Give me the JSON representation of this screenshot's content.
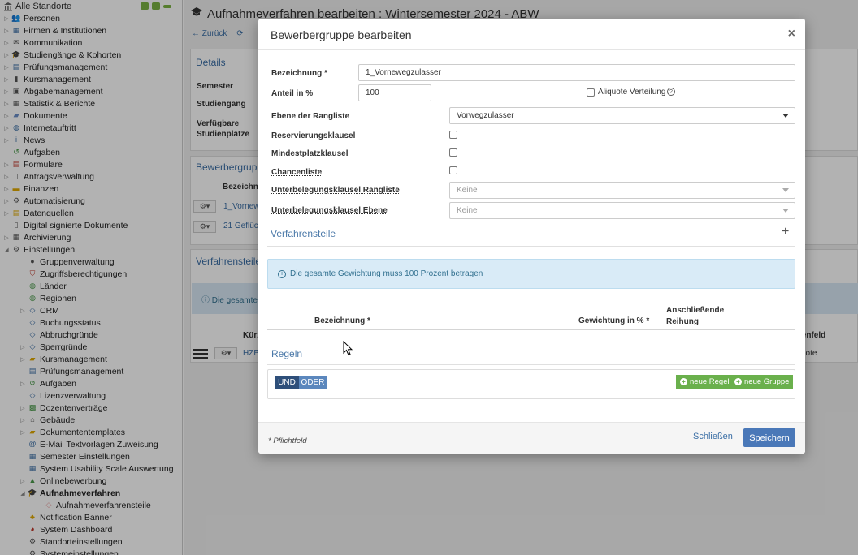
{
  "sidebar": {
    "root": "Alle Standorte",
    "items": [
      {
        "label": "Personen",
        "icon": "people-icon",
        "color": "#8a5a9e",
        "toggle": true
      },
      {
        "label": "Firmen & Institutionen",
        "icon": "chart-icon",
        "color": "#3a6ea5",
        "toggle": true
      },
      {
        "label": "Kommunikation",
        "icon": "mail-icon",
        "color": "#666666",
        "toggle": true
      },
      {
        "label": "Studiengänge & Kohorten",
        "icon": "graduation-icon",
        "color": "#3a6ea5",
        "toggle": true
      },
      {
        "label": "Prüfungsmanagement",
        "icon": "clipboard-icon",
        "color": "#3a6ea5",
        "toggle": true
      },
      {
        "label": "Kursmanagement",
        "icon": "book-icon",
        "color": "#555555",
        "toggle": true
      },
      {
        "label": "Abgabemanagement",
        "icon": "upload-icon",
        "color": "#555555",
        "toggle": true
      },
      {
        "label": "Statistik & Berichte",
        "icon": "report-icon",
        "color": "#555555",
        "toggle": true
      },
      {
        "label": "Dokumente",
        "icon": "folder-icon",
        "color": "#6a8fc7",
        "toggle": true
      },
      {
        "label": "Internetauftritt",
        "icon": "globe-icon",
        "color": "#3a6ea5",
        "toggle": true
      },
      {
        "label": "News",
        "icon": "info-icon",
        "color": "#3a6ea5",
        "toggle": true
      },
      {
        "label": "Aufgaben",
        "icon": "history-icon",
        "color": "#4a9a4a",
        "toggle": false
      },
      {
        "label": "Formulare",
        "icon": "form-icon",
        "color": "#c0392b",
        "toggle": true
      },
      {
        "label": "Antragsverwaltung",
        "icon": "document-icon",
        "color": "#555555",
        "toggle": true
      },
      {
        "label": "Finanzen",
        "icon": "money-icon",
        "color": "#e0a800",
        "toggle": true
      },
      {
        "label": "Automatisierung",
        "icon": "gear-icon",
        "color": "#555555",
        "toggle": true
      },
      {
        "label": "Datenquellen",
        "icon": "database-icon",
        "color": "#e0a800",
        "toggle": true
      },
      {
        "label": "Digital signierte Dokumente",
        "icon": "signed-document-icon",
        "color": "#555555",
        "toggle": false
      },
      {
        "label": "Archivierung",
        "icon": "archive-icon",
        "color": "#555555",
        "toggle": true
      },
      {
        "label": "Einstellungen",
        "icon": "gear-icon",
        "color": "#555555",
        "toggle": true,
        "expanded": true
      }
    ],
    "sub_items": [
      {
        "label": "Gruppenverwaltung",
        "icon": "user-group-icon",
        "color": "#555555",
        "toggle": false
      },
      {
        "label": "Zugriffsberechtigungen",
        "icon": "shield-icon",
        "color": "#c0392b",
        "toggle": false
      },
      {
        "label": "Länder",
        "icon": "globe-icon",
        "color": "#4a9a4a",
        "toggle": false
      },
      {
        "label": "Regionen",
        "icon": "globe-icon",
        "color": "#4a9a4a",
        "toggle": false
      },
      {
        "label": "CRM",
        "icon": "tag-icon",
        "color": "#3a6ea5",
        "toggle": true
      },
      {
        "label": "Buchungsstatus",
        "icon": "tag-icon",
        "color": "#3a6ea5",
        "toggle": false
      },
      {
        "label": "Abbruchgründe",
        "icon": "tag-icon",
        "color": "#3a6ea5",
        "toggle": false
      },
      {
        "label": "Sperrgründe",
        "icon": "tag-icon",
        "color": "#3a6ea5",
        "toggle": true
      },
      {
        "label": "Kursmanagement",
        "icon": "folder-icon",
        "color": "#e0a800",
        "toggle": true
      },
      {
        "label": "Prüfungsmanagement",
        "icon": "clipboard-icon",
        "color": "#3a6ea5",
        "toggle": false
      },
      {
        "label": "Aufgaben",
        "icon": "history-icon",
        "color": "#4a9a4a",
        "toggle": true
      },
      {
        "label": "Lizenzverwaltung",
        "icon": "tag-icon",
        "color": "#3a6ea5",
        "toggle": false
      },
      {
        "label": "Dozentenverträge",
        "icon": "contract-icon",
        "color": "#4a9a4a",
        "toggle": true
      },
      {
        "label": "Gebäude",
        "icon": "home-icon",
        "color": "#555555",
        "toggle": true
      },
      {
        "label": "Dokumententemplates",
        "icon": "folder-icon",
        "color": "#e0a800",
        "toggle": true
      },
      {
        "label": "E-Mail Textvorlagen Zuweisung",
        "icon": "at-icon",
        "color": "#3a6ea5",
        "toggle": false
      },
      {
        "label": "Semester Einstellungen",
        "icon": "calendar-icon",
        "color": "#3a6ea5",
        "toggle": false
      },
      {
        "label": "System Usability Scale Auswertung",
        "icon": "chart-icon",
        "color": "#3a6ea5",
        "toggle": false
      },
      {
        "label": "Onlinebewerbung",
        "icon": "application-icon",
        "color": "#4a9a4a",
        "toggle": true
      },
      {
        "label": "Aufnahmeverfahren",
        "icon": "graduation-icon",
        "color": "#3a6ea5",
        "toggle": true,
        "expanded": true,
        "active": true
      }
    ],
    "sub_sub_items": [
      {
        "label": "Aufnahmeverfahrensteile",
        "icon": "tag-icon",
        "color": "#e8a0a0"
      }
    ],
    "bottom_items": [
      {
        "label": "Notification Banner",
        "icon": "bell-icon",
        "color": "#e0a800"
      },
      {
        "label": "System Dashboard",
        "icon": "dashboard-icon",
        "color": "#c0392b"
      },
      {
        "label": "Standorteinstellungen",
        "icon": "gear-icon",
        "color": "#555555"
      },
      {
        "label": "Systemeinstellungen",
        "icon": "gear-icon",
        "color": "#555555"
      }
    ]
  },
  "main": {
    "title": "Aufnahmeverfahren bearbeiten : Wintersemester 2024 - ABW",
    "toolbar": {
      "back": "Zurück"
    },
    "details_heading": "Details",
    "details_labels": [
      "Semester",
      "Studiengang",
      "Verfügbare Studienplätze"
    ],
    "bewerbergruppen_heading": "Bewerbergrup",
    "bewerbergruppen_col": "Bezeichn",
    "bewerbergruppen_rows": [
      "1_Vornew",
      "21 Geflüch"
    ],
    "verfahrensteile_heading": "Verfahrensteile",
    "info_text": "Die gesamte",
    "table_col_kuerzel": "Kürz",
    "table_row_hzb": "HZB",
    "right_col": "lenfeld",
    "right_cell": "note"
  },
  "modal": {
    "title": "Bewerbergruppe bearbeiten",
    "close_label": "×",
    "fields": {
      "bezeichnung_label": "Bezeichnung *",
      "bezeichnung_value": "1_Vornewegzulasser",
      "anteil_label": "Anteil in %",
      "anteil_value": "100",
      "aliquote_label": "Aliquote Verteilung",
      "ebene_label": "Ebene der Rangliste",
      "ebene_value": "Vorwegzulasser",
      "reservierung_label": "Reservierungsklausel",
      "mindestplatz_label": "Mindestplatzklausel",
      "chancenliste_label": "Chancenliste",
      "unterbelegung_rangliste_label": "Unterbelegungsklausel Rangliste",
      "unterbelegung_rangliste_value": "Keine",
      "unterbelegung_ebene_label": "Unterbelegungsklausel Ebene",
      "unterbelegung_ebene_value": "Keine"
    },
    "verfahrensteile_title": "Verfahrensteile",
    "info_message": "Die gesamte Gewichtung muss 100 Prozent betragen",
    "table_headers": {
      "bezeichnung": "Bezeichnung *",
      "gewichtung": "Gewichtung in % *",
      "reihung": "Anschließende Reihung"
    },
    "regeln_title": "Regeln",
    "und_label": "UND",
    "oder_label": "ODER",
    "neue_regel_label": "neue Regel",
    "neue_gruppe_label": "neue Gruppe",
    "pflichtfeld_note": "* Pflichtfeld",
    "schliessen_label": "Schließen",
    "speichern_label": "Speichern"
  }
}
